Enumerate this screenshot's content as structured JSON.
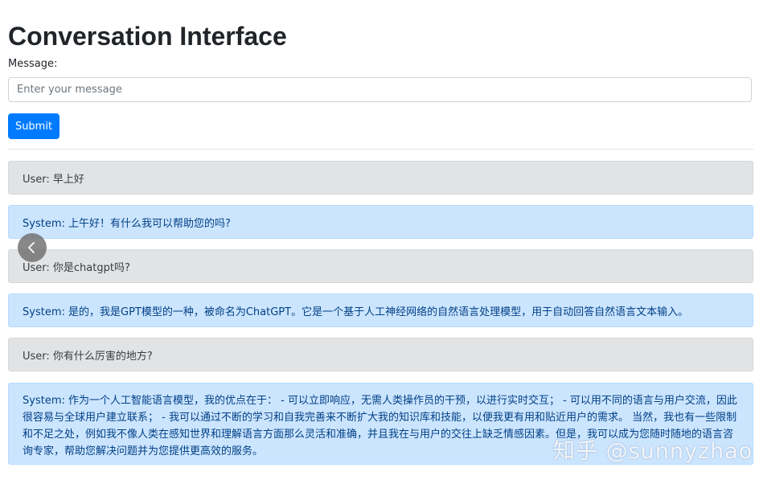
{
  "header": {
    "title": "Conversation Interface"
  },
  "form": {
    "message_label": "Message:",
    "message_placeholder": "Enter your message",
    "message_value": "",
    "submit_label": "Submit"
  },
  "conversation": [
    {
      "role": "user",
      "text": "User: 早上好"
    },
    {
      "role": "system",
      "text": "System: 上午好！有什么我可以帮助您的吗?"
    },
    {
      "role": "user",
      "text": "User: 你是chatgpt吗?"
    },
    {
      "role": "system",
      "text": "System: 是的，我是GPT模型的一种，被命名为ChatGPT。它是一个基于人工神经网络的自然语言处理模型，用于自动回答自然语言文本输入。"
    },
    {
      "role": "user",
      "text": "User: 你有什么厉害的地方?"
    },
    {
      "role": "system",
      "text": "System: 作为一个人工智能语言模型，我的优点在于： - 可以立即响应，无需人类操作员的干预，以进行实时交互； - 可以用不同的语言与用户交流，因此很容易与全球用户建立联系； - 我可以通过不断的学习和自我完善来不断扩大我的知识库和技能，以便我更有用和贴近用户的需求。 当然，我也有一些限制和不足之处，例如我不像人类在感知世界和理解语言方面那么灵活和准确，并且我在与用户的交往上缺乏情感因素。但是，我可以成为您随时随地的语言咨询专家，帮助您解决问题并为您提供更高效的服务。"
    }
  ],
  "overlay": {
    "prev_icon": "chevron-left-icon",
    "watermark": "知乎 @sunnyzhao"
  },
  "colors": {
    "primary": "#007bff",
    "user_bubble": "#e2e3e5",
    "system_bubble": "#cce5ff",
    "system_text": "#004085"
  }
}
